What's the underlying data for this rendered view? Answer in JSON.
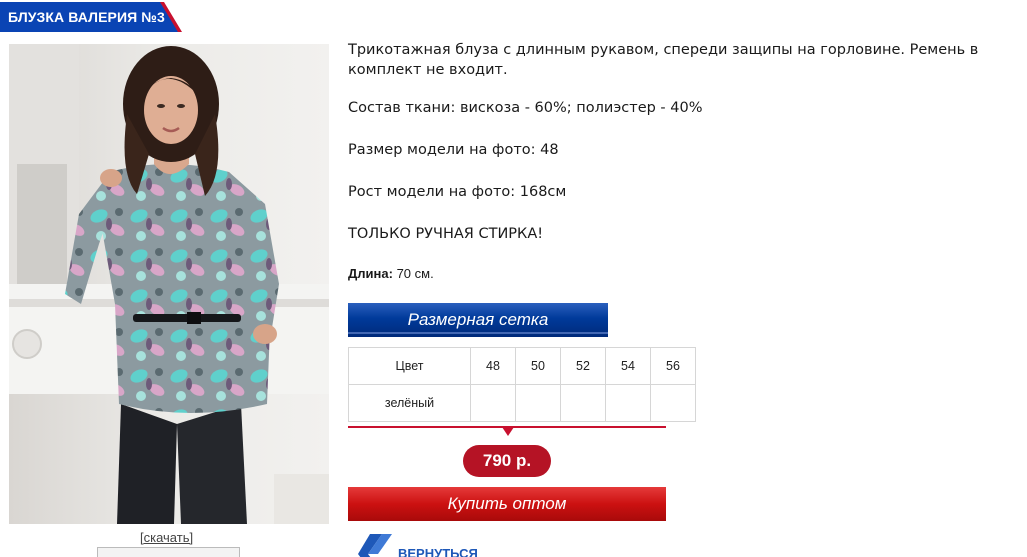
{
  "product": {
    "title": "БЛУЗКА ВАЛЕРИЯ №3",
    "download_label": "[скачать]",
    "description": [
      "Трикотажная блуза с длинным рукавом, спереди защипы на горловине. Ремень в комплект не входит.",
      "Состав ткани: вискоза - 60%; полиэстер - 40%",
      "Размер модели на фото: 48",
      "Рост модели на фото: 168см",
      "ТОЛЬКО РУЧНАЯ СТИРКА!"
    ],
    "length_label": "Длина:",
    "length_value": "70 см."
  },
  "size_chart": {
    "banner_label": "Размерная сетка",
    "header": "Цвет",
    "sizes": [
      "48",
      "50",
      "52",
      "54",
      "56"
    ],
    "rows": [
      {
        "color": "зелёный",
        "cells": [
          "",
          "",
          "",
          "",
          ""
        ]
      }
    ]
  },
  "price": {
    "label": "790 р."
  },
  "actions": {
    "buy_label": "Купить оптом",
    "back_label": "ВЕРНУТЬСЯ"
  },
  "icons": {
    "back": "double-chevron-left-icon"
  },
  "colors": {
    "brand_blue": "#003a9a",
    "accent_red": "#c8102e",
    "link_blue": "#1e58b8"
  }
}
